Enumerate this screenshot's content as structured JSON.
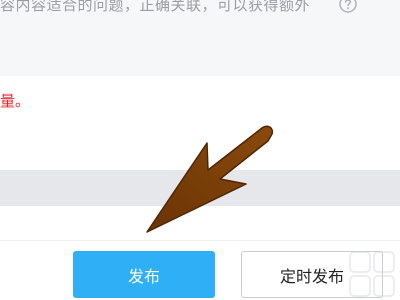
{
  "notice": {
    "text": "容内容适合的问题，正确关联，可以获得额外",
    "help_icon": "question-circle-icon"
  },
  "warning": {
    "text": "量。",
    "color": "#e3282f"
  },
  "actions": {
    "publish_label": "发布",
    "schedule_label": "定时发布",
    "accent_color": "#2fb0f6"
  },
  "annotation": {
    "icon": "arrow-pointer-icon",
    "color": "#7a3f06"
  }
}
